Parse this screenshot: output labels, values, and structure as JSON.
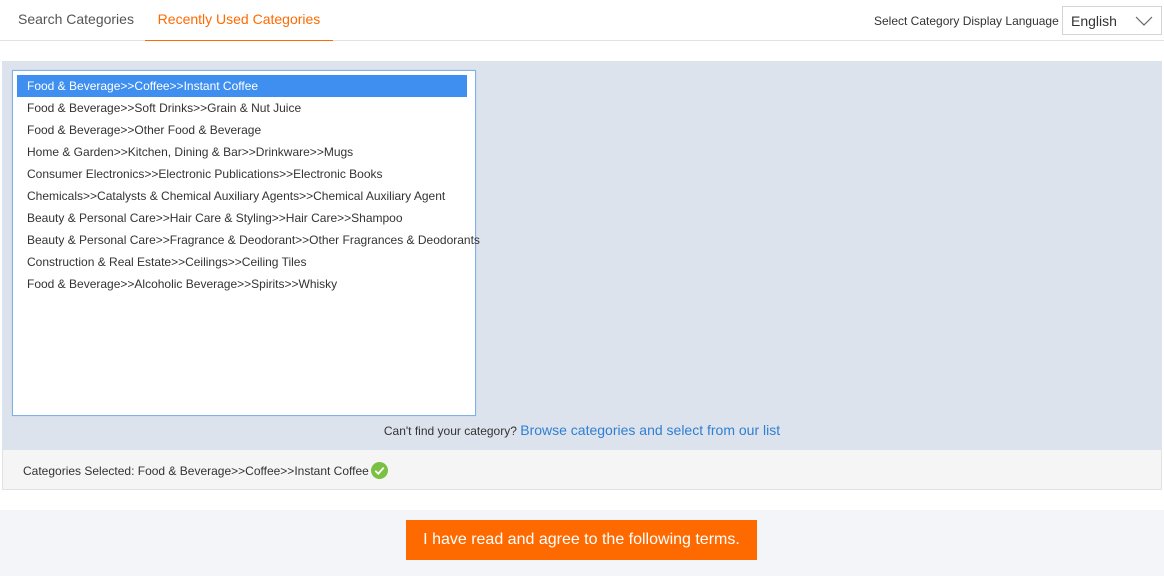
{
  "tabs": {
    "search": "Search Categories",
    "recent": "Recently Used Categories"
  },
  "language": {
    "label": "Select Category Display Language",
    "value": "English"
  },
  "recent_list": [
    "Food & Beverage>>Coffee>>Instant Coffee",
    "Food & Beverage>>Soft Drinks>>Grain & Nut Juice",
    "Food & Beverage>>Other Food & Beverage",
    "Home & Garden>>Kitchen, Dining & Bar>>Drinkware>>Mugs",
    "Consumer Electronics>>Electronic Publications>>Electronic Books",
    "Chemicals>>Catalysts & Chemical Auxiliary Agents>>Chemical Auxiliary Agent",
    "Beauty & Personal Care>>Hair Care & Styling>>Hair Care>>Shampoo",
    "Beauty & Personal Care>>Fragrance & Deodorant>>Other Fragrances & Deodorants",
    "Construction & Real Estate>>Ceilings>>Ceiling Tiles",
    "Food & Beverage>>Alcoholic Beverage>>Spirits>>Whisky"
  ],
  "selected_index": 0,
  "help": {
    "question": "Can't find your category?",
    "link": "Browse categories and select from our list"
  },
  "selection": {
    "label": "Categories Selected:",
    "value": "Food & Beverage>>Coffee>>Instant Coffee"
  },
  "agree_button": "I have read and agree to the following terms.",
  "colors": {
    "accent": "#ff6a00",
    "selected_row": "#3f8ff0",
    "link": "#2f7fd2",
    "check": "#7ac143"
  },
  "icons": {
    "language_dropdown": "chevron-down-icon",
    "selection_status": "check-circle-icon"
  }
}
